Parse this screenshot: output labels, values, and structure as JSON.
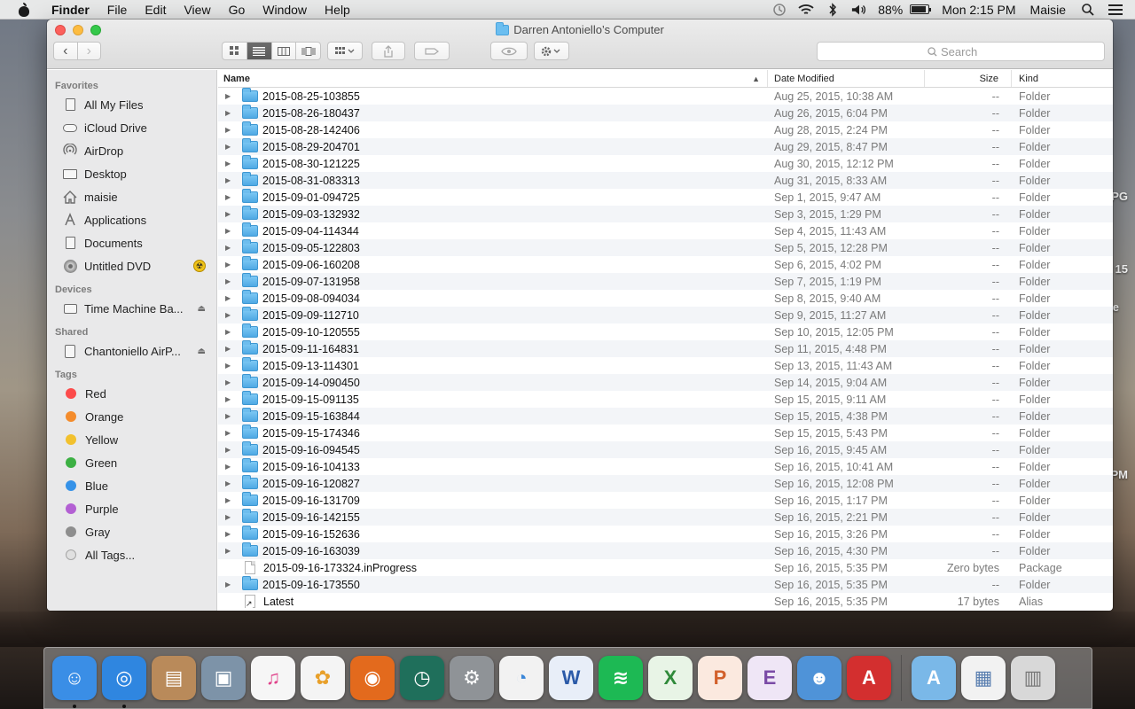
{
  "menubar": {
    "app": "Finder",
    "items": [
      "File",
      "Edit",
      "View",
      "Go",
      "Window",
      "Help"
    ],
    "battery_percent": "88%",
    "clock": "Mon 2:15 PM",
    "user": "Maisie"
  },
  "window": {
    "title": "Darren Antoniello’s Computer",
    "search_placeholder": "Search"
  },
  "sidebar": {
    "favorites_header": "Favorites",
    "favorites": [
      {
        "label": "All My Files",
        "icon": "all-files-icon"
      },
      {
        "label": "iCloud Drive",
        "icon": "cloud-icon"
      },
      {
        "label": "AirDrop",
        "icon": "airdrop-icon"
      },
      {
        "label": "Desktop",
        "icon": "desktop-icon"
      },
      {
        "label": "maisie",
        "icon": "home-icon"
      },
      {
        "label": "Applications",
        "icon": "applications-icon"
      },
      {
        "label": "Documents",
        "icon": "documents-icon"
      },
      {
        "label": "Untitled DVD",
        "icon": "dvd-icon"
      }
    ],
    "devices_header": "Devices",
    "devices": [
      {
        "label": "Time Machine Ba..."
      }
    ],
    "shared_header": "Shared",
    "shared": [
      {
        "label": "Chantoniello AirP..."
      }
    ],
    "tags_header": "Tags",
    "tags": [
      {
        "label": "Red",
        "color": "#fc4b4b"
      },
      {
        "label": "Orange",
        "color": "#f48c2c"
      },
      {
        "label": "Yellow",
        "color": "#f2c12e"
      },
      {
        "label": "Green",
        "color": "#3cb043"
      },
      {
        "label": "Blue",
        "color": "#3592e8"
      },
      {
        "label": "Purple",
        "color": "#b360d3"
      },
      {
        "label": "Gray",
        "color": "#8e8e8e"
      }
    ],
    "all_tags": "All Tags..."
  },
  "columns": {
    "name": "Name",
    "date": "Date Modified",
    "size": "Size",
    "kind": "Kind"
  },
  "rows": [
    {
      "name": "2015-08-25-103855",
      "date": "Aug 25, 2015, 10:38 AM",
      "size": "--",
      "kind": "Folder",
      "type": "folder"
    },
    {
      "name": "2015-08-26-180437",
      "date": "Aug 26, 2015, 6:04 PM",
      "size": "--",
      "kind": "Folder",
      "type": "folder"
    },
    {
      "name": "2015-08-28-142406",
      "date": "Aug 28, 2015, 2:24 PM",
      "size": "--",
      "kind": "Folder",
      "type": "folder"
    },
    {
      "name": "2015-08-29-204701",
      "date": "Aug 29, 2015, 8:47 PM",
      "size": "--",
      "kind": "Folder",
      "type": "folder"
    },
    {
      "name": "2015-08-30-121225",
      "date": "Aug 30, 2015, 12:12 PM",
      "size": "--",
      "kind": "Folder",
      "type": "folder"
    },
    {
      "name": "2015-08-31-083313",
      "date": "Aug 31, 2015, 8:33 AM",
      "size": "--",
      "kind": "Folder",
      "type": "folder"
    },
    {
      "name": "2015-09-01-094725",
      "date": "Sep 1, 2015, 9:47 AM",
      "size": "--",
      "kind": "Folder",
      "type": "folder"
    },
    {
      "name": "2015-09-03-132932",
      "date": "Sep 3, 2015, 1:29 PM",
      "size": "--",
      "kind": "Folder",
      "type": "folder"
    },
    {
      "name": "2015-09-04-114344",
      "date": "Sep 4, 2015, 11:43 AM",
      "size": "--",
      "kind": "Folder",
      "type": "folder"
    },
    {
      "name": "2015-09-05-122803",
      "date": "Sep 5, 2015, 12:28 PM",
      "size": "--",
      "kind": "Folder",
      "type": "folder"
    },
    {
      "name": "2015-09-06-160208",
      "date": "Sep 6, 2015, 4:02 PM",
      "size": "--",
      "kind": "Folder",
      "type": "folder"
    },
    {
      "name": "2015-09-07-131958",
      "date": "Sep 7, 2015, 1:19 PM",
      "size": "--",
      "kind": "Folder",
      "type": "folder"
    },
    {
      "name": "2015-09-08-094034",
      "date": "Sep 8, 2015, 9:40 AM",
      "size": "--",
      "kind": "Folder",
      "type": "folder"
    },
    {
      "name": "2015-09-09-112710",
      "date": "Sep 9, 2015, 11:27 AM",
      "size": "--",
      "kind": "Folder",
      "type": "folder"
    },
    {
      "name": "2015-09-10-120555",
      "date": "Sep 10, 2015, 12:05 PM",
      "size": "--",
      "kind": "Folder",
      "type": "folder"
    },
    {
      "name": "2015-09-11-164831",
      "date": "Sep 11, 2015, 4:48 PM",
      "size": "--",
      "kind": "Folder",
      "type": "folder"
    },
    {
      "name": "2015-09-13-114301",
      "date": "Sep 13, 2015, 11:43 AM",
      "size": "--",
      "kind": "Folder",
      "type": "folder"
    },
    {
      "name": "2015-09-14-090450",
      "date": "Sep 14, 2015, 9:04 AM",
      "size": "--",
      "kind": "Folder",
      "type": "folder"
    },
    {
      "name": "2015-09-15-091135",
      "date": "Sep 15, 2015, 9:11 AM",
      "size": "--",
      "kind": "Folder",
      "type": "folder"
    },
    {
      "name": "2015-09-15-163844",
      "date": "Sep 15, 2015, 4:38 PM",
      "size": "--",
      "kind": "Folder",
      "type": "folder"
    },
    {
      "name": "2015-09-15-174346",
      "date": "Sep 15, 2015, 5:43 PM",
      "size": "--",
      "kind": "Folder",
      "type": "folder"
    },
    {
      "name": "2015-09-16-094545",
      "date": "Sep 16, 2015, 9:45 AM",
      "size": "--",
      "kind": "Folder",
      "type": "folder"
    },
    {
      "name": "2015-09-16-104133",
      "date": "Sep 16, 2015, 10:41 AM",
      "size": "--",
      "kind": "Folder",
      "type": "folder"
    },
    {
      "name": "2015-09-16-120827",
      "date": "Sep 16, 2015, 12:08 PM",
      "size": "--",
      "kind": "Folder",
      "type": "folder"
    },
    {
      "name": "2015-09-16-131709",
      "date": "Sep 16, 2015, 1:17 PM",
      "size": "--",
      "kind": "Folder",
      "type": "folder"
    },
    {
      "name": "2015-09-16-142155",
      "date": "Sep 16, 2015, 2:21 PM",
      "size": "--",
      "kind": "Folder",
      "type": "folder"
    },
    {
      "name": "2015-09-16-152636",
      "date": "Sep 16, 2015, 3:26 PM",
      "size": "--",
      "kind": "Folder",
      "type": "folder"
    },
    {
      "name": "2015-09-16-163039",
      "date": "Sep 16, 2015, 4:30 PM",
      "size": "--",
      "kind": "Folder",
      "type": "folder"
    },
    {
      "name": "2015-09-16-173324.inProgress",
      "date": "Sep 16, 2015, 5:35 PM",
      "size": "Zero bytes",
      "kind": "Package",
      "type": "file"
    },
    {
      "name": "2015-09-16-173550",
      "date": "Sep 16, 2015, 5:35 PM",
      "size": "--",
      "kind": "Folder",
      "type": "folder"
    },
    {
      "name": "Latest",
      "date": "Sep 16, 2015, 5:35 PM",
      "size": "17 bytes",
      "kind": "Alias",
      "type": "alias"
    }
  ],
  "desktop_fragments": [
    "PG",
    "15",
    "e",
    "PM"
  ],
  "dock": [
    {
      "name": "finder-icon",
      "bg": "#3a8ee6",
      "running": true
    },
    {
      "name": "safari-icon",
      "bg": "#2f86e0",
      "running": true
    },
    {
      "name": "contacts-icon",
      "bg": "#b98a5a",
      "running": false
    },
    {
      "name": "image-capture-icon",
      "bg": "#7d93a8",
      "running": false
    },
    {
      "name": "itunes-icon",
      "bg": "#f6f6f6",
      "running": false
    },
    {
      "name": "photos-icon",
      "bg": "#f4f4f4",
      "running": false
    },
    {
      "name": "firefox-icon",
      "bg": "#e36a1d",
      "running": false
    },
    {
      "name": "time-machine-icon",
      "bg": "#1f6f5b",
      "running": false
    },
    {
      "name": "system-preferences-icon",
      "bg": "#8f9397",
      "running": false
    },
    {
      "name": "picasa-icon",
      "bg": "#f2f2f2",
      "running": false
    },
    {
      "name": "word-icon",
      "bg": "#e8eef8",
      "running": false
    },
    {
      "name": "spotify-icon",
      "bg": "#1db954",
      "running": false
    },
    {
      "name": "excel-icon",
      "bg": "#e8f4e6",
      "running": false
    },
    {
      "name": "powerpoint-icon",
      "bg": "#fbe9df",
      "running": false
    },
    {
      "name": "entourage-icon",
      "bg": "#efe6f6",
      "running": false
    },
    {
      "name": "messenger-icon",
      "bg": "#4f93d8",
      "running": false
    },
    {
      "name": "acrobat-icon",
      "bg": "#d32f2f",
      "running": false
    },
    {
      "name": "applications-folder-icon",
      "bg": "#7ab8e8",
      "running": false
    },
    {
      "name": "downloads-stack-icon",
      "bg": "#f2f2f2",
      "running": false
    },
    {
      "name": "trash-icon",
      "bg": "#d8d8d8",
      "running": false
    }
  ]
}
